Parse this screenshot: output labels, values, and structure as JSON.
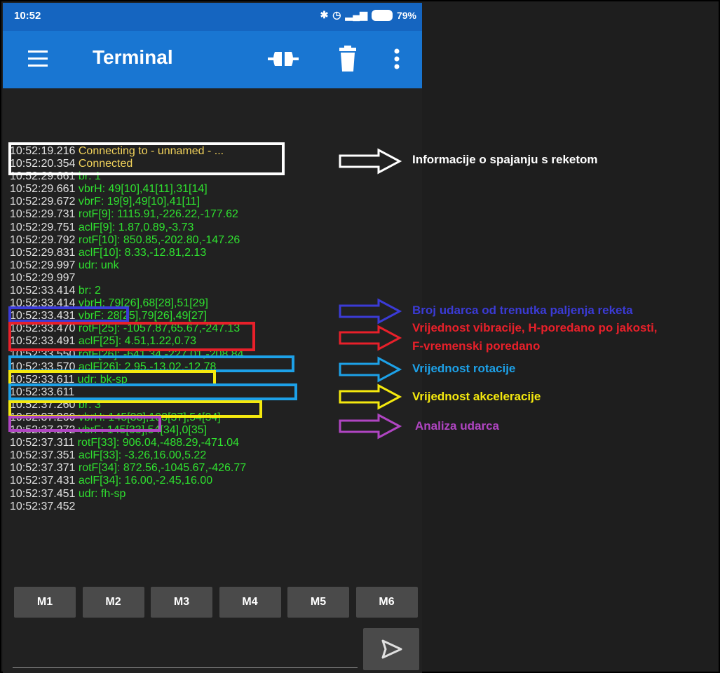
{
  "status_bar": {
    "time": "10:52",
    "icons": [
      "bluetooth-icon",
      "alarm-icon",
      "signal-icon"
    ],
    "battery": "79%"
  },
  "app_bar": {
    "title": "Terminal",
    "icons": [
      "menu-icon",
      "plug-icon",
      "trash-icon",
      "more-icon"
    ]
  },
  "log": [
    {
      "ts": "10:52:19.216",
      "msg": " Connecting to - unnamed - ...",
      "color": "#f2d35b"
    },
    {
      "ts": "10:52:20.354",
      "msg": " Connected",
      "color": "#f2d35b"
    },
    {
      "ts": "10:52:29.661",
      "msg": " br: 1",
      "color": "#2fe02f"
    },
    {
      "ts": "10:52:29.661",
      "msg": " vbrH: 49[10],41[11],31[14]",
      "color": "#2fe02f"
    },
    {
      "ts": "10:52:29.672",
      "msg": " vbrF: 19[9],49[10],41[11]",
      "color": "#2fe02f"
    },
    {
      "ts": "10:52:29.731",
      "msg": " rotF[9]: 1115.91,-226.22,-177.62",
      "color": "#2fe02f"
    },
    {
      "ts": "10:52:29.751",
      "msg": " aclF[9]: 1.87,0.89,-3.73",
      "color": "#2fe02f"
    },
    {
      "ts": "10:52:29.792",
      "msg": " rotF[10]: 850.85,-202.80,-147.26",
      "color": "#2fe02f"
    },
    {
      "ts": "10:52:29.831",
      "msg": " aclF[10]: 8.33,-12.81,2.13",
      "color": "#2fe02f"
    },
    {
      "ts": "10:52:29.997",
      "msg": " udr: unk",
      "color": "#2fe02f"
    },
    {
      "ts": "10:52:29.997",
      "msg": "",
      "color": "#2fe02f"
    },
    {
      "ts": "10:52:33.414",
      "msg": " br: 2",
      "color": "#2fe02f"
    },
    {
      "ts": "10:52:33.414",
      "msg": " vbrH: 79[26],68[28],51[29]",
      "color": "#2fe02f"
    },
    {
      "ts": "10:52:33.431",
      "msg": " vbrF: 28[25],79[26],49[27]",
      "color": "#2fe02f"
    },
    {
      "ts": "10:52:33.470",
      "msg": " rotF[25]: -1057.87,65.67,-247.13",
      "color": "#2fe02f"
    },
    {
      "ts": "10:52:33.491",
      "msg": " aclF[25]: 4.51,1.22,0.73",
      "color": "#2fe02f"
    },
    {
      "ts": "10:52:33.550",
      "msg": " rotF[26]: -641.34,-227.01,-208.84",
      "color": "#2fe02f"
    },
    {
      "ts": "10:52:33.570",
      "msg": " aclF[26]: 2.95,-13.02,-12.78",
      "color": "#2fe02f"
    },
    {
      "ts": "10:52:33.611",
      "msg": " udr: bk-sp",
      "color": "#2fe02f"
    },
    {
      "ts": "10:52:33.611",
      "msg": "",
      "color": "#2fe02f"
    },
    {
      "ts": "10:52:37.260",
      "msg": " br: 3",
      "color": "#2fe02f"
    },
    {
      "ts": "10:52:37.260",
      "msg": " vbrH: 145[33],103[37],54[34]",
      "color": "#2fe02f"
    },
    {
      "ts": "10:52:37.272",
      "msg": " vbrF: 145[33],54[34],0[35]",
      "color": "#2fe02f"
    },
    {
      "ts": "10:52:37.311",
      "msg": " rotF[33]: 906.04,-488.29,-471.04",
      "color": "#2fe02f"
    },
    {
      "ts": "10:52:37.351",
      "msg": " aclF[33]: -3.26,16.00,5.22",
      "color": "#2fe02f"
    },
    {
      "ts": "10:52:37.371",
      "msg": " rotF[34]: 872.56,-1045.67,-426.77",
      "color": "#2fe02f"
    },
    {
      "ts": "10:52:37.431",
      "msg": " aclF[34]: 16.00,-2.45,16.00",
      "color": "#2fe02f"
    },
    {
      "ts": "10:52:37.451",
      "msg": " udr: fh-sp",
      "color": "#2fe02f"
    },
    {
      "ts": "10:52:37.452",
      "msg": "",
      "color": "#2fe02f"
    }
  ],
  "macros": [
    "M1",
    "M2",
    "M3",
    "M4",
    "M5",
    "M6"
  ],
  "input": {
    "value": "",
    "placeholder": ""
  },
  "annotations": {
    "connection": {
      "text": "Informacije o spajanju s reketom",
      "color": "#ffffff"
    },
    "stroke_count": {
      "text": "Broj udarca od trenutka paljenja reketa",
      "color": "#3b3bd6"
    },
    "vibration_line1": {
      "text": "Vrijednost vibracije, H-poredano po jakosti,",
      "color": "#e8202a"
    },
    "vibration_line2": {
      "text": "F-vremenski poredano",
      "color": "#e8202a"
    },
    "rotation": {
      "text": "Vrijednost rotacije",
      "color": "#1da1e8"
    },
    "acceleration": {
      "text": "Vrijednost akceleracije",
      "color": "#f5e90e"
    },
    "stroke_analysis": {
      "text": "Analiza udarca",
      "color": "#b045c2"
    }
  }
}
